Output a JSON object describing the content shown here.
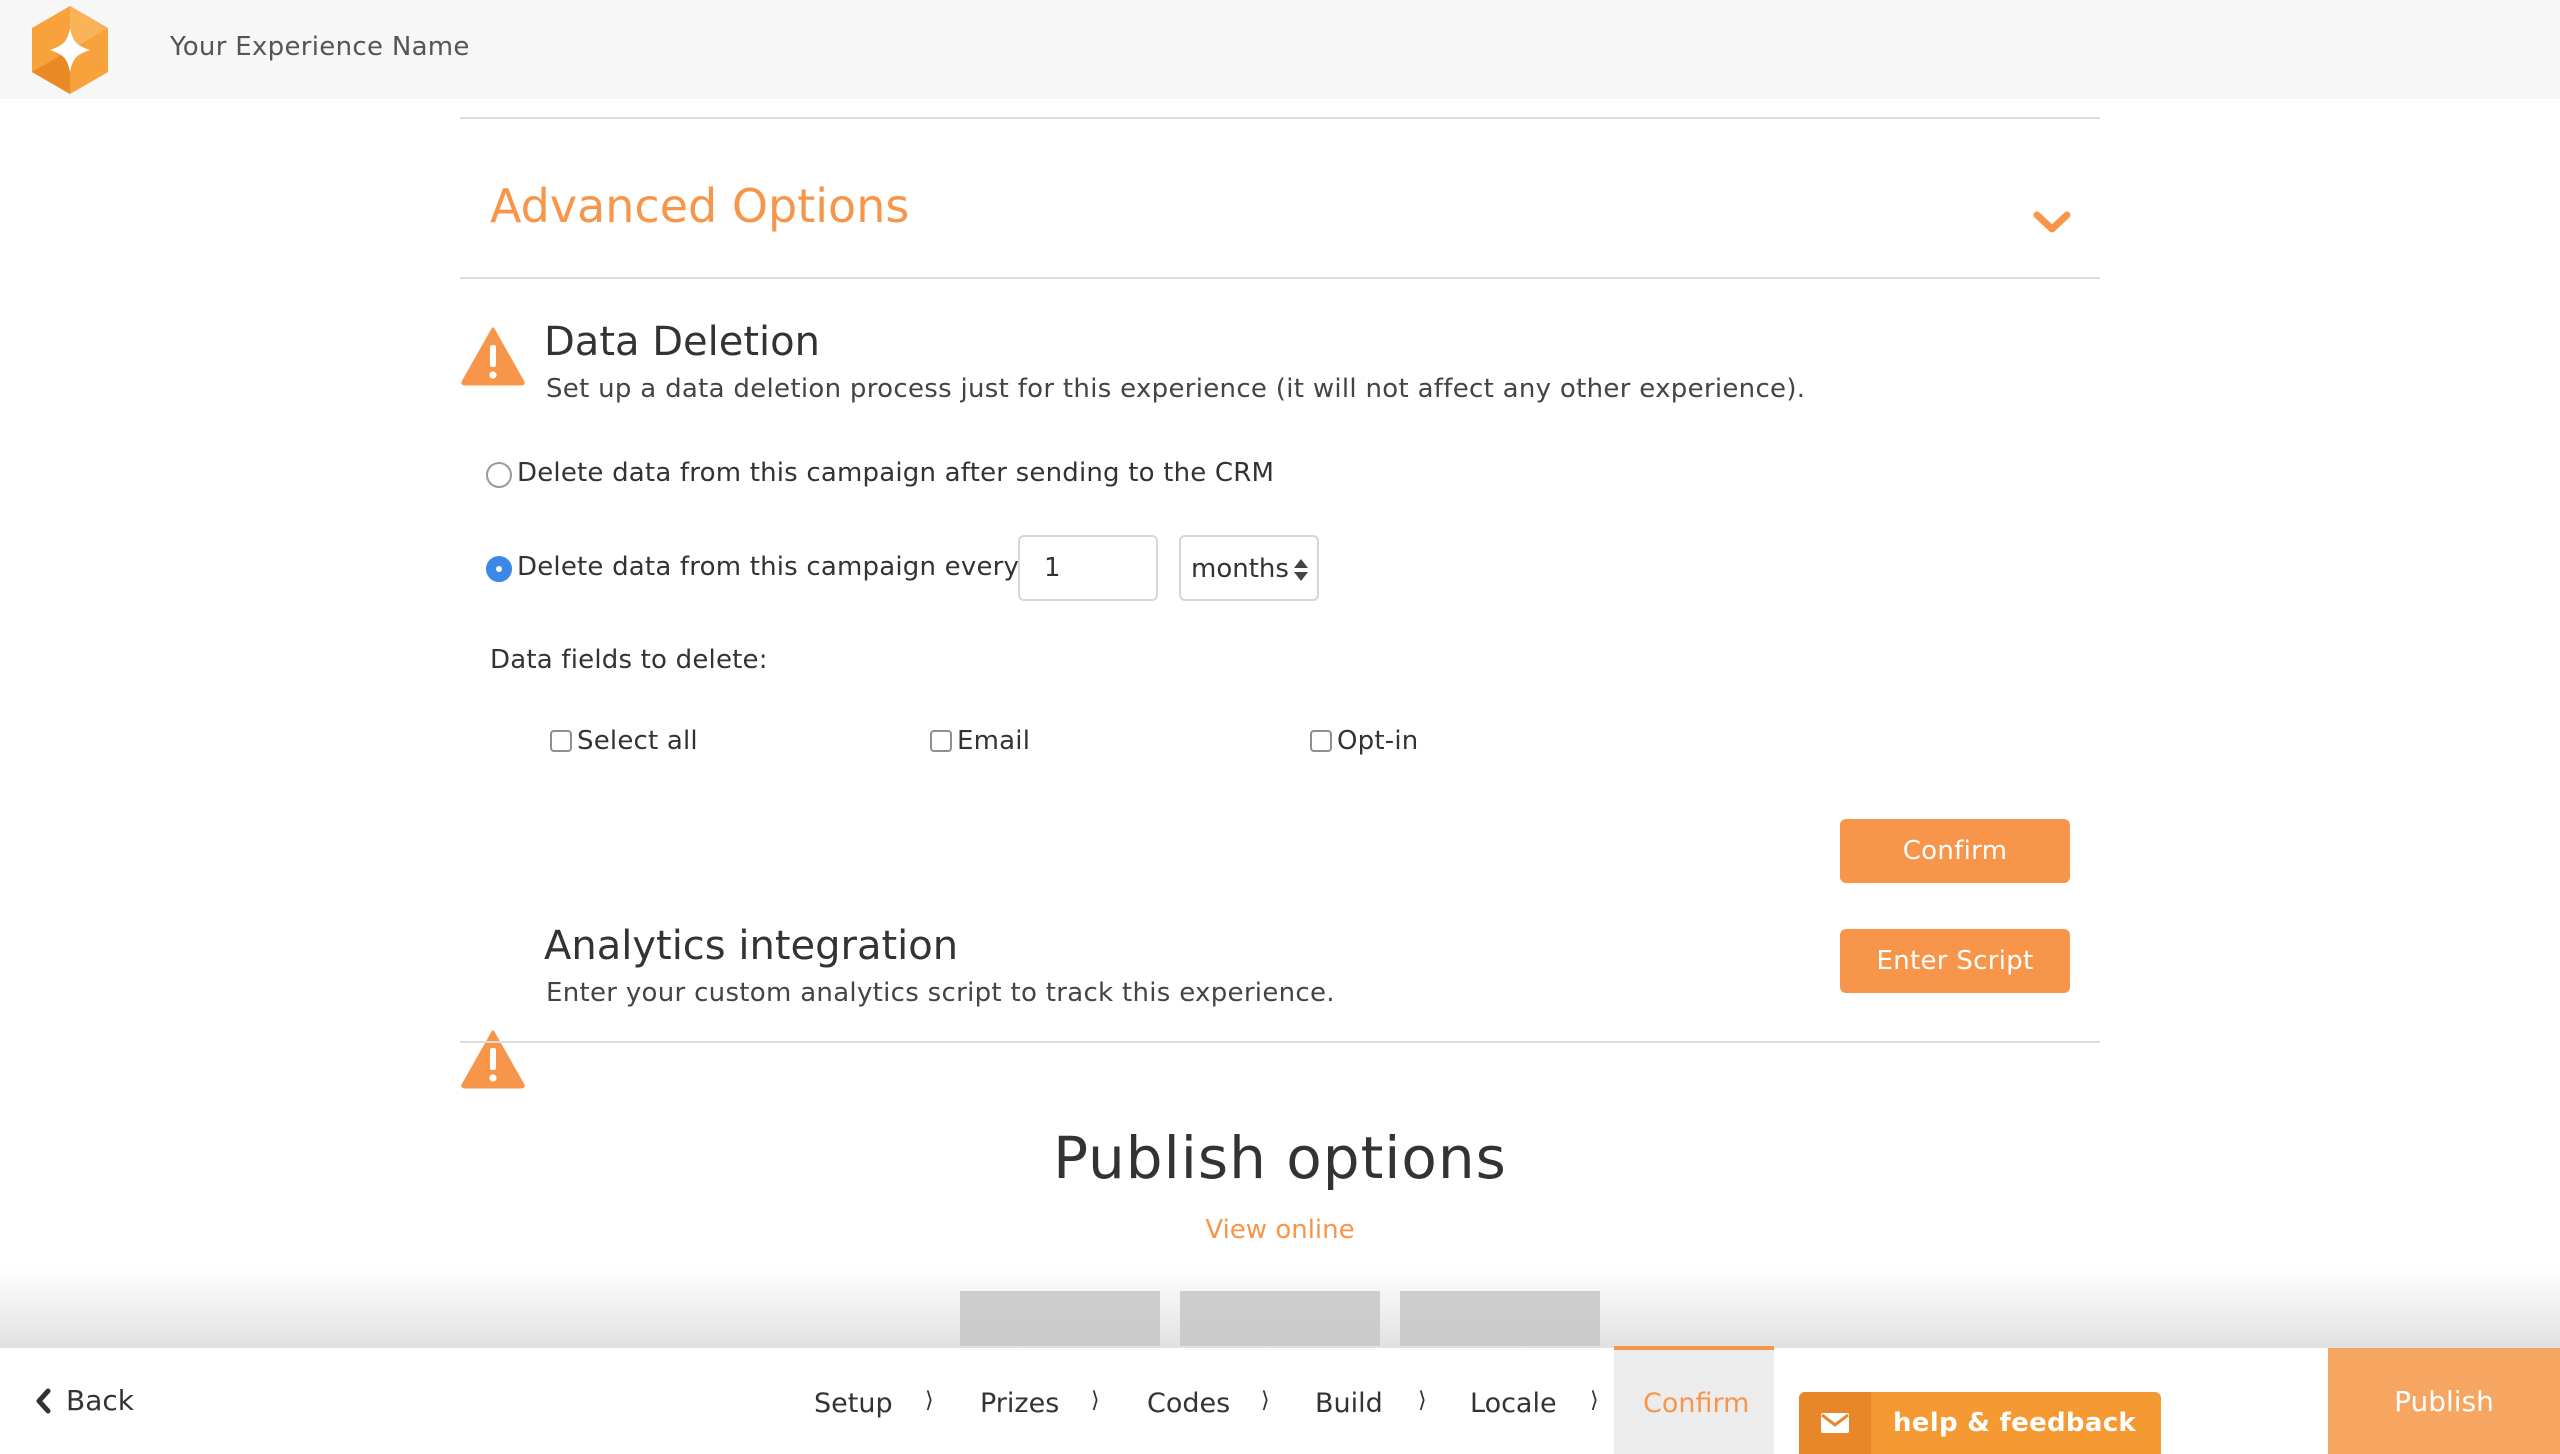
{
  "header": {
    "experience_name": "Your Experience Name"
  },
  "advanced": {
    "title": "Advanced Options"
  },
  "data_deletion": {
    "title": "Data Deletion",
    "description": "Set up a data deletion process just for this experience (it will not affect any other experience).",
    "option_after_crm": "Delete data from this campaign after sending to the CRM",
    "option_every": "Delete data from this campaign every",
    "interval_value": "1",
    "interval_unit": "months",
    "fields_label": "Data fields to delete:",
    "fields": [
      "Select all",
      "Email",
      "Opt-in"
    ],
    "confirm_label": "Confirm"
  },
  "analytics": {
    "title": "Analytics integration",
    "description": "Enter your custom analytics script to track this experience.",
    "button_label": "Enter Script"
  },
  "publish": {
    "title": "Publish options",
    "view_online": "View online"
  },
  "footer": {
    "back_label": "Back",
    "steps": [
      "Setup",
      "Prizes",
      "Codes",
      "Build",
      "Locale",
      "Confirm"
    ],
    "active_step": "Confirm",
    "help_label": "help & feedback",
    "publish_label": "Publish"
  },
  "colors": {
    "accent": "#f7964a",
    "radio_selected": "#3b88e8"
  }
}
